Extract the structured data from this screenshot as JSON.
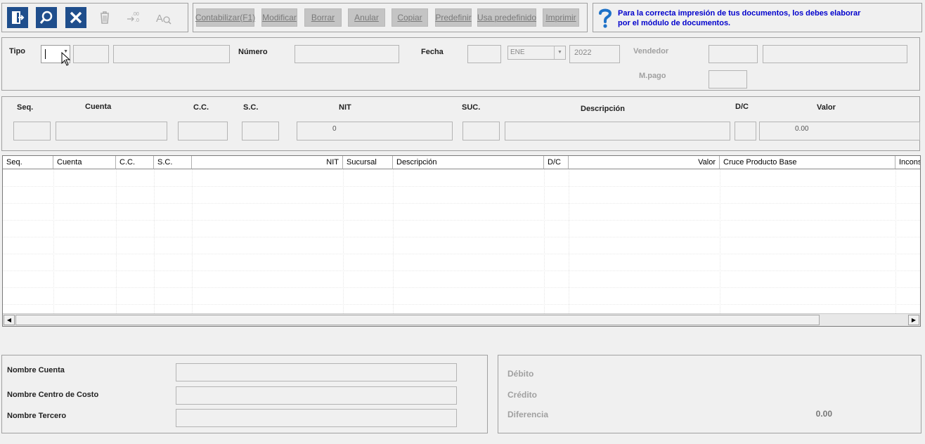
{
  "toolbar": {
    "icons": [
      {
        "name": "exit-icon",
        "enabled": true
      },
      {
        "name": "search-icon",
        "enabled": true
      },
      {
        "name": "close-icon",
        "enabled": true
      },
      {
        "name": "trash-icon",
        "enabled": false
      },
      {
        "name": "decimal-shift-icon",
        "enabled": false
      },
      {
        "name": "spellcheck-icon",
        "enabled": false
      }
    ],
    "buttons": {
      "contabilizar": "Contabilizar(F1)",
      "modificar": "Modificar",
      "borrar": "Borrar",
      "anular": "Anular",
      "copiar": "Copiar",
      "predefinir": "Predefinir",
      "usa_predefinido": "Usa predefinido",
      "imprimir": "Imprimir"
    },
    "help_icon": "question-icon",
    "help_text_line1": "Para la correcta impresión de tus documentos, los debes elaborar",
    "help_text_line2": "por el módulo de documentos."
  },
  "header": {
    "tipo_label": "Tipo",
    "numero_label": "Número",
    "fecha_label": "Fecha",
    "fecha_month": "ENE",
    "fecha_year": "2022",
    "vendedor_label": "Vendedor",
    "mpago_label": "M.pago"
  },
  "entry": {
    "seq_label": "Seq.",
    "cuenta_label": "Cuenta",
    "cc_label": "C.C.",
    "sc_label": "S.C.",
    "nit_label": "NIT",
    "suc_label": "SUC.",
    "descripcion_label": "Descripción",
    "dc_label": "D/C",
    "valor_label": "Valor",
    "nit_value": "0",
    "valor_value": "0.00"
  },
  "grid": {
    "columns": [
      "Seq.",
      "Cuenta",
      "C.C.",
      "S.C.",
      "NIT",
      "Sucursal",
      "Descripción",
      "D/C",
      "Valor",
      "Cruce Producto Base",
      "Incons"
    ],
    "rows": []
  },
  "names": {
    "nombre_cuenta": "Nombre Cuenta",
    "nombre_centro": "Nombre Centro de Costo",
    "nombre_tercero": "Nombre Tercero"
  },
  "totals": {
    "debito_label": "Débito",
    "credito_label": "Crédito",
    "diferencia_label": "Diferencia",
    "diferencia_value": "0.00"
  },
  "colors": {
    "toolbar_icon_bg": "#1f4e8c",
    "help_text": "#0000cc",
    "disabled_text": "#a0a0a0"
  }
}
